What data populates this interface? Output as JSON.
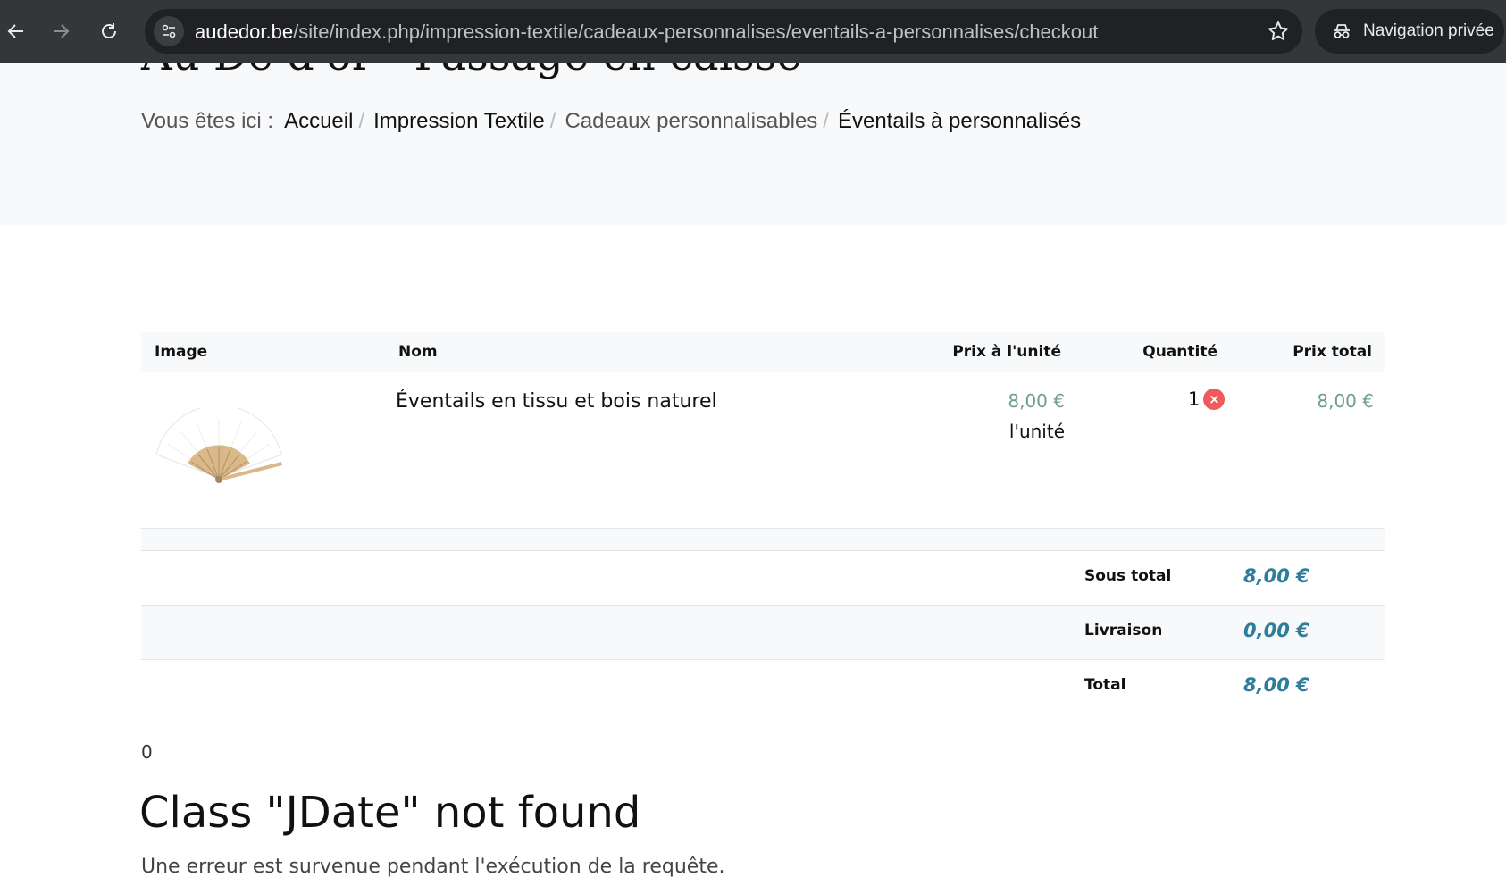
{
  "browser": {
    "url_host": "audedor.be",
    "url_path": "/site/index.php/impression-textile/cadeaux-personnalises/eventails-a-personnalises/checkout",
    "incognito_label": "Navigation privée",
    "colors": {
      "chrome_bg": "#35363a",
      "omnibox_bg": "#202124"
    }
  },
  "header": {
    "title": "Au Dé d'or - Passage en caisse",
    "breadcrumb_label": "Vous êtes ici :",
    "breadcrumb": [
      {
        "label": "Accueil"
      },
      {
        "label": "Impression Textile"
      },
      {
        "label": "Cadeaux personnalisables"
      },
      {
        "label": "Éventails à personnalisés"
      }
    ],
    "separator": "/"
  },
  "cart": {
    "columns": {
      "image": "Image",
      "name": "Nom",
      "unit_price": "Prix à l'unité",
      "quantity": "Quantité",
      "total_price": "Prix total"
    },
    "items": [
      {
        "image_icon": "hand-fan-image",
        "name": "Éventails en tissu et bois naturel",
        "unit_price": "8,00 €",
        "unit_suffix": "l'unité",
        "quantity": "1",
        "remove_icon": "×",
        "total_price": "8,00 €"
      }
    ],
    "summary": {
      "subtotal_label": "Sous total",
      "subtotal_value": "8,00 €",
      "shipping_label": "Livraison",
      "shipping_value": "0,00 €",
      "total_label": "Total",
      "total_value": "8,00 €"
    },
    "colors": {
      "price": "#6e9e8e",
      "summary": "#2e7d9a",
      "remove": "#f05a5a"
    }
  },
  "error": {
    "code": "0",
    "title": "Class \"JDate\" not found",
    "message": "Une erreur est survenue pendant l'exécution de la requête."
  }
}
